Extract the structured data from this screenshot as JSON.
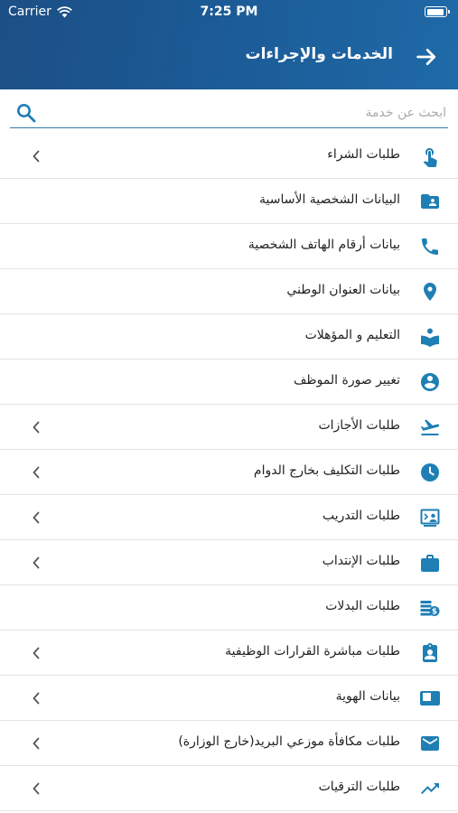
{
  "status_bar": {
    "carrier": "Carrier",
    "time": "7:25 PM"
  },
  "header": {
    "title": "الخدمات والإجراءات"
  },
  "search": {
    "placeholder": "ابحث عن خدمة",
    "value": ""
  },
  "colors": {
    "header_start": "#1d4f86",
    "header_end": "#1f6aa8",
    "accent": "#1f7fb4",
    "divider": "#e3e3e3"
  },
  "items": [
    {
      "label": "طلبات الشراء",
      "icon": "touch-icon",
      "chevron": true
    },
    {
      "label": "البيانات الشخصية الأساسية",
      "icon": "contact-folder-icon",
      "chevron": false
    },
    {
      "label": "بيانات أرقام الهاتف الشخصية",
      "icon": "phone-icon",
      "chevron": false
    },
    {
      "label": "بيانات العنوان الوطني",
      "icon": "location-pin-icon",
      "chevron": false
    },
    {
      "label": "التعليم و المؤهلات",
      "icon": "education-icon",
      "chevron": false
    },
    {
      "label": "تغيير صورة الموظف",
      "icon": "account-circle-icon",
      "chevron": false
    },
    {
      "label": "طلبات الأجازات",
      "icon": "airplane-departure-icon",
      "chevron": true
    },
    {
      "label": "طلبات التكليف بخارج الدوام",
      "icon": "clock-icon",
      "chevron": true
    },
    {
      "label": "طلبات التدريب",
      "icon": "presentation-icon",
      "chevron": true
    },
    {
      "label": "طلبات الإنتداب",
      "icon": "briefcase-icon",
      "chevron": true
    },
    {
      "label": "طلبات البدلات",
      "icon": "money-icon",
      "chevron": false
    },
    {
      "label": "طلبات مباشرة القرارات الوظيفية",
      "icon": "id-badge-icon",
      "chevron": true
    },
    {
      "label": "بيانات الهوية",
      "icon": "id-card-icon",
      "chevron": true
    },
    {
      "label": "طلبات مكافأة موزعي البريد(خارج الوزارة)",
      "icon": "mail-icon",
      "chevron": true
    },
    {
      "label": "طلبات الترقيات",
      "icon": "trending-up-icon",
      "chevron": true
    }
  ]
}
